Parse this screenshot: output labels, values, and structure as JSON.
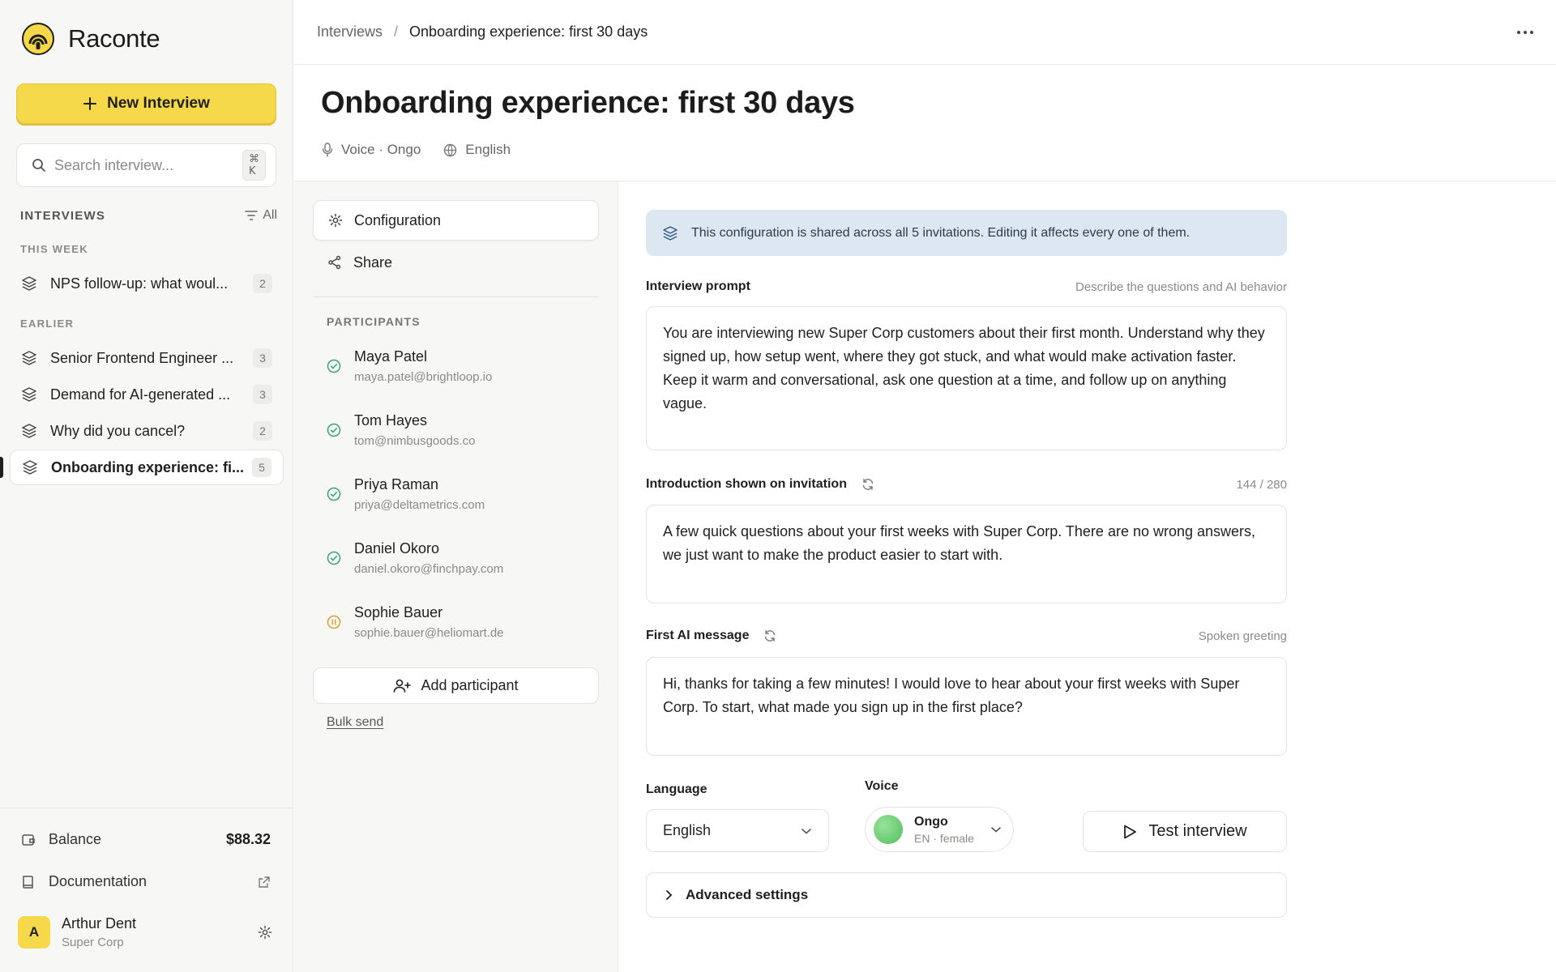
{
  "app": {
    "name": "Raconte"
  },
  "sidebar": {
    "new_button": "New Interview",
    "search": {
      "placeholder": "Search interview...",
      "shortcut": "⌘ K"
    },
    "section_title": "INTERVIEWS",
    "filter_label": "All",
    "groups": [
      {
        "label": "THIS WEEK"
      },
      {
        "label": "EARLIER"
      }
    ],
    "items": [
      {
        "label": "NPS follow-up: what woul...",
        "count": "2"
      },
      {
        "label": "Senior Frontend Engineer ...",
        "count": "3"
      },
      {
        "label": "Demand for AI-generated ...",
        "count": "3"
      },
      {
        "label": "Why did you cancel?",
        "count": "2"
      },
      {
        "label": "Onboarding experience: fi...",
        "count": "5"
      }
    ],
    "balance": {
      "label": "Balance",
      "value": "$88.32"
    },
    "documentation": "Documentation",
    "user": {
      "initial": "A",
      "name": "Arthur Dent",
      "org": "Super Corp"
    }
  },
  "topbar": {
    "breadcrumb_root": "Interviews",
    "breadcrumb_sep": "/",
    "breadcrumb_current": "Onboarding experience: first 30 days"
  },
  "header": {
    "title": "Onboarding experience: first 30 days",
    "voice_meta": "Voice · Ongo",
    "language_meta": "English"
  },
  "tabs": [
    {
      "label": "Configuration"
    },
    {
      "label": "Share"
    }
  ],
  "participants": {
    "title": "PARTICIPANTS",
    "list": [
      {
        "name": "Maya Patel",
        "email": "maya.patel@brightloop.io",
        "status": "completed"
      },
      {
        "name": "Tom Hayes",
        "email": "tom@nimbusgoods.co",
        "status": "completed"
      },
      {
        "name": "Priya Raman",
        "email": "priya@deltametrics.com",
        "status": "completed"
      },
      {
        "name": "Daniel Okoro",
        "email": "daniel.okoro@finchpay.com",
        "status": "completed"
      },
      {
        "name": "Sophie Bauer",
        "email": "sophie.bauer@heliomart.de",
        "status": "paused"
      }
    ],
    "add_button": "Add participant",
    "bulk_send": "Bulk send"
  },
  "config": {
    "banner": "This configuration is shared across all 5 invitations. Editing it affects every one of them.",
    "prompt": {
      "label": "Interview prompt",
      "hint": "Describe the questions and AI behavior",
      "text": "You are interviewing new Super Corp customers about their first month. Understand why they signed up, how setup went, where they got stuck, and what would make activation faster. Keep it warm and conversational, ask one question at a time, and follow up on anything vague."
    },
    "intro": {
      "label": "Introduction shown on invitation",
      "hint": "144 / 280",
      "text": "A few quick questions about your first weeks with Super Corp. There are no wrong answers, we just want to make the product easier to start with."
    },
    "first_message": {
      "label": "First AI message",
      "hint": "Spoken greeting",
      "text": "Hi, thanks for taking a few minutes! I would love to hear about your first weeks with Super Corp. To start, what made you sign up in the first place?"
    },
    "language": {
      "label": "Language",
      "value": "English"
    },
    "voice": {
      "label": "Voice",
      "name": "Ongo",
      "sub": "EN · female"
    },
    "test_button": "Test interview",
    "advanced": "Advanced settings"
  },
  "colors": {
    "accent": "#f6d94a",
    "banner_bg": "#dde7f1",
    "status_completed": "#3aa37a",
    "status_paused": "#d9a233"
  }
}
